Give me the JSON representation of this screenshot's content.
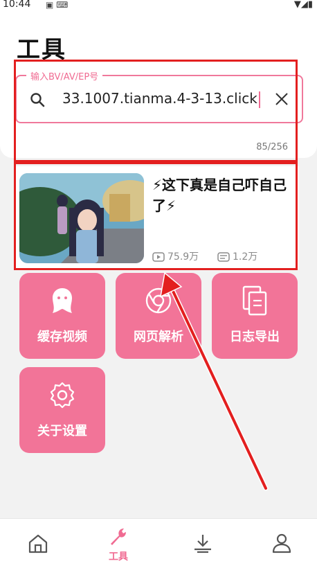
{
  "status_bar": {
    "time": "10:44"
  },
  "page": {
    "title": "工具"
  },
  "search": {
    "label": "输入BV/AV/EP号",
    "value": "33.1007.tianma.4-3-13.click",
    "counter": "85/256"
  },
  "video": {
    "title": "⚡这下真是自己吓自己了⚡",
    "views": "75.9万",
    "comments": "1.2万"
  },
  "tools": [
    {
      "label": "缓存视频",
      "icon": "bilibili-tv-icon"
    },
    {
      "label": "网页解析",
      "icon": "chrome-icon"
    },
    {
      "label": "日志导出",
      "icon": "copy-file-icon"
    },
    {
      "label": "关于设置",
      "icon": "gear-icon"
    }
  ],
  "bottom_nav": [
    {
      "icon": "home-icon",
      "label": ""
    },
    {
      "icon": "wrench-icon",
      "label": "工具",
      "active": true
    },
    {
      "icon": "download-icon",
      "label": ""
    },
    {
      "icon": "profile-icon",
      "label": ""
    }
  ],
  "colors": {
    "accent": "#f27498",
    "annotation": "#e31f1f"
  }
}
